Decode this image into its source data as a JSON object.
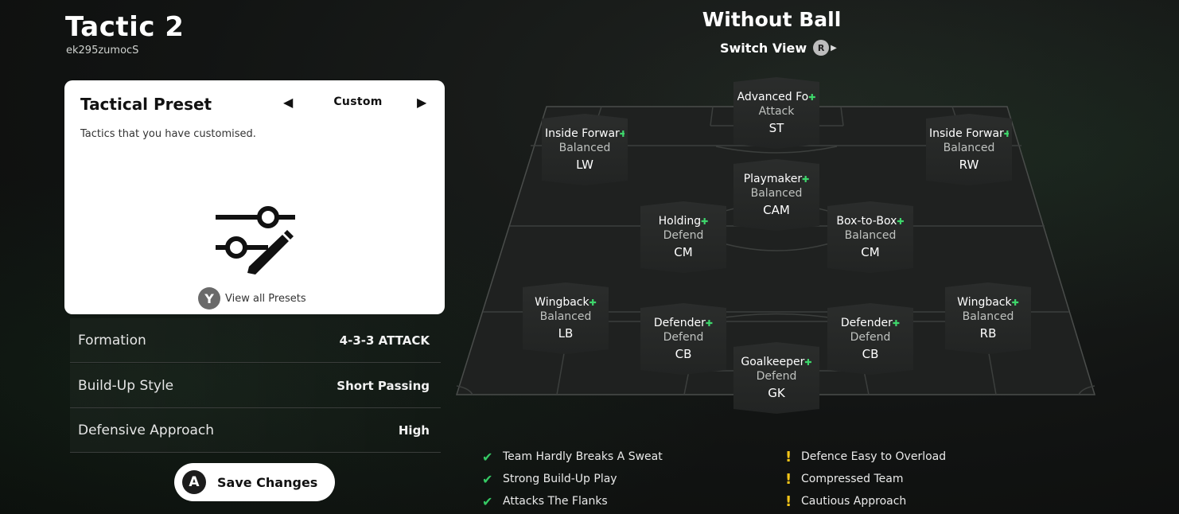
{
  "header": {
    "title": "Tactic 2",
    "subtitle": "ek295zumocS"
  },
  "preset": {
    "heading": "Tactical Preset",
    "value": "Custom",
    "description": "Tactics that you have customised.",
    "view_all_button": "Y",
    "view_all_label": "View all Presets"
  },
  "settings": [
    {
      "label": "Formation",
      "value": "4-3-3 ATTACK"
    },
    {
      "label": "Build-Up Style",
      "value": "Short Passing"
    },
    {
      "label": "Defensive Approach",
      "value": "High"
    }
  ],
  "save": {
    "button_key": "A",
    "label": "Save Changes"
  },
  "view": {
    "title": "Without Ball",
    "switch_label": "Switch View",
    "switch_key": "R"
  },
  "players": [
    {
      "role": "Advanced Fo",
      "mentality": "Attack",
      "position": "ST"
    },
    {
      "role": "Inside Forwar",
      "mentality": "Balanced",
      "position": "LW"
    },
    {
      "role": "Inside Forwar",
      "mentality": "Balanced",
      "position": "RW"
    },
    {
      "role": "Playmaker",
      "mentality": "Balanced",
      "position": "CAM"
    },
    {
      "role": "Holding",
      "mentality": "Defend",
      "position": "CM"
    },
    {
      "role": "Box-to-Box",
      "mentality": "Balanced",
      "position": "CM"
    },
    {
      "role": "Wingback",
      "mentality": "Balanced",
      "position": "LB"
    },
    {
      "role": "Defender",
      "mentality": "Defend",
      "position": "CB"
    },
    {
      "role": "Defender",
      "mentality": "Defend",
      "position": "CB"
    },
    {
      "role": "Wingback",
      "mentality": "Balanced",
      "position": "RB"
    },
    {
      "role": "Goalkeeper",
      "mentality": "Defend",
      "position": "GK"
    }
  ],
  "strengths": [
    "Team Hardly Breaks A Sweat",
    "Strong Build-Up Play",
    "Attacks The Flanks"
  ],
  "weaknesses": [
    "Defence Easy to Overload",
    "Compressed Team",
    "Cautious Approach"
  ],
  "colors": {
    "positive": "#35c964",
    "warning": "#f5c518",
    "role_plus": "#3ed66b"
  }
}
